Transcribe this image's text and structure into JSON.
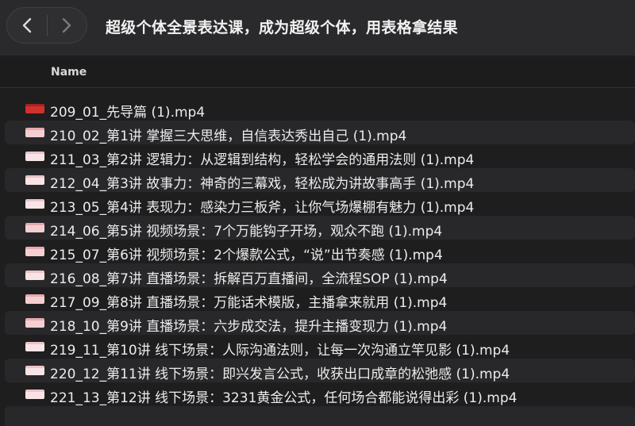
{
  "window": {
    "title": "超级个体全景表达课，成为超级个体，用表格拿结果"
  },
  "nav": {
    "back_icon": "chevron-left-icon",
    "forward_icon": "chevron-right-icon"
  },
  "columns": {
    "name": "Name"
  },
  "files": [
    {
      "name": "209_01_先导篇 (1).mp4",
      "icon": "video-file-icon",
      "icon_color": "#d0312d"
    },
    {
      "name": "210_02_第1讲 掌握三大思维，自信表达秀出自己 (1).mp4",
      "icon": "video-file-icon",
      "icon_color": "#f4cfd2"
    },
    {
      "name": "211_03_第2讲 逻辑力：从逻辑到结构，轻松学会的通用法则 (1).mp4",
      "icon": "video-file-icon",
      "icon_color": "#f8e4e6"
    },
    {
      "name": "212_04_第3讲 故事力：神奇的三幕戏，轻松成为讲故事高手 (1).mp4",
      "icon": "video-file-icon",
      "icon_color": "#f8e4e6"
    },
    {
      "name": "213_05_第4讲 表现力：感染力三板斧，让你气场爆棚有魅力 (1).mp4",
      "icon": "video-file-icon",
      "icon_color": "#f8e4e6"
    },
    {
      "name": "214_06_第5讲 视频场景：7个万能钩子开场，观众不跑 (1).mp4",
      "icon": "video-file-icon",
      "icon_color": "#f4cfd2"
    },
    {
      "name": "215_07_第6讲 视频场景：2个爆款公式，“说”出节奏感 (1).mp4",
      "icon": "video-file-icon",
      "icon_color": "#f4cfd2"
    },
    {
      "name": "216_08_第7讲 直播场景：拆解百万直播间，全流程SOP (1).mp4",
      "icon": "video-file-icon",
      "icon_color": "#f8e4e6"
    },
    {
      "name": "217_09_第8讲 直播场景：万能话术模版，主播拿来就用 (1).mp4",
      "icon": "video-file-icon",
      "icon_color": "#f4cfd2"
    },
    {
      "name": "218_10_第9讲 直播场景：六步成交法，提升主播变现力 (1).mp4",
      "icon": "video-file-icon",
      "icon_color": "#f4cfd2"
    },
    {
      "name": "219_11_第10讲 线下场景：人际沟通法则，让每一次沟通立竿见影 (1).mp4",
      "icon": "video-file-icon",
      "icon_color": "#f8e4e6"
    },
    {
      "name": "220_12_第11讲 线下场景：即兴发言公式，收获出口成章的松弛感 (1).mp4",
      "icon": "video-file-icon",
      "icon_color": "#f8e4e6"
    },
    {
      "name": "221_13_第12讲 线下场景：3231黄金公式，任何场合都能说得出彩 (1).mp4",
      "icon": "video-file-icon",
      "icon_color": "#f8e4e6"
    }
  ]
}
